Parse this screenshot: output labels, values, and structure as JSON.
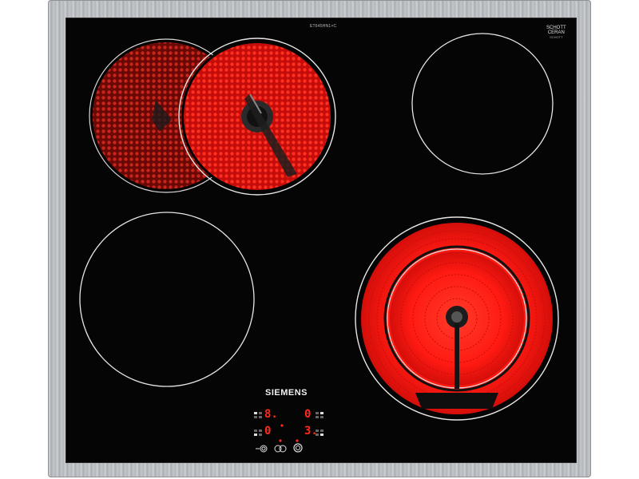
{
  "product": {
    "model_label": "ET645HN1×C",
    "brand": "SIEMENS",
    "glass_brand_line1": "SCHOTT",
    "glass_brand_line2": "CERAN",
    "glass_brand_sub": "SCHOTT"
  },
  "cooking_zones": [
    {
      "name": "rear-left-dual-zone",
      "state": "on",
      "color": "#ff1a1a"
    },
    {
      "name": "rear-right-zone",
      "state": "off"
    },
    {
      "name": "front-left-zone",
      "state": "off"
    },
    {
      "name": "front-right-dual-zone",
      "state": "on",
      "color": "#ff1a1a"
    }
  ],
  "control_panel": {
    "displays": {
      "rear_left": "8.",
      "rear_right": "0",
      "front_left": "0",
      "front_right": "3."
    },
    "buttons": [
      {
        "name": "extended-zone-button",
        "icon": "dual-ring-icon"
      },
      {
        "name": "extended-zone-button-2",
        "icon": "double-circle-icon"
      },
      {
        "name": "power-button",
        "icon": "power-icon"
      }
    ],
    "indicator_color": "#ff2a1a"
  },
  "colors": {
    "glass": "#050505",
    "frame": "#bfc2c5",
    "heat": "#ff1a1a"
  }
}
